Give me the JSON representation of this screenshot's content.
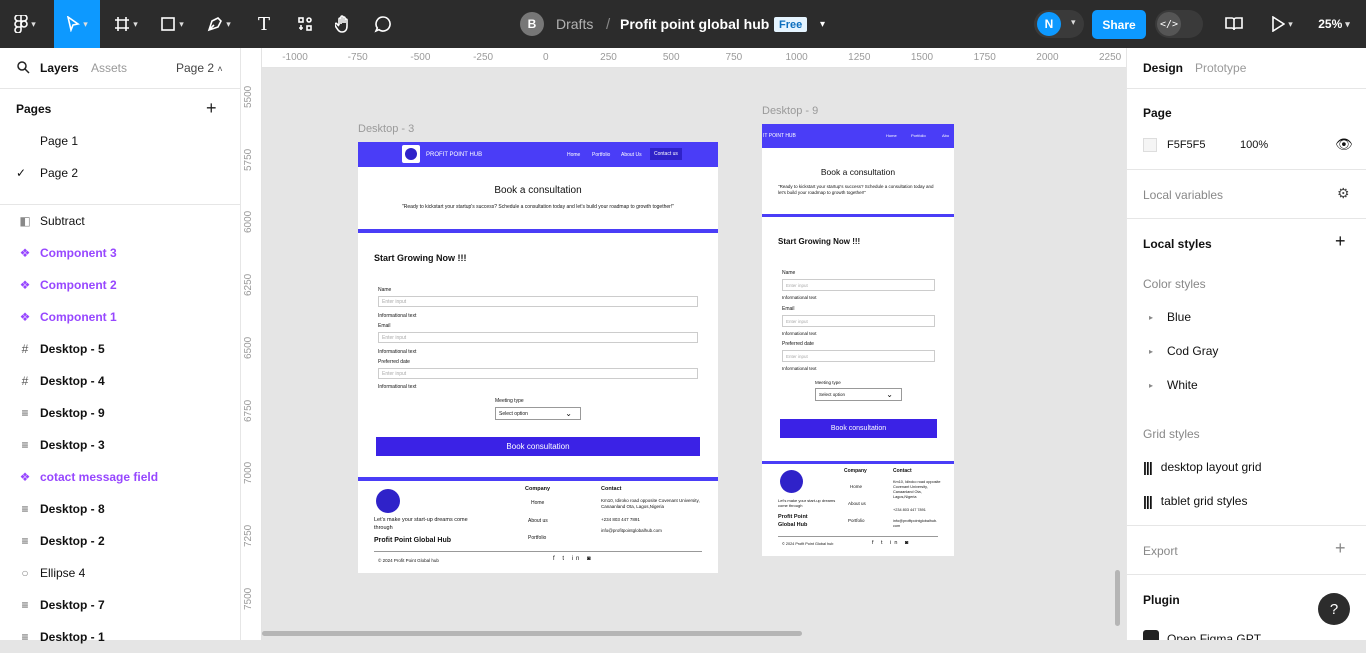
{
  "toolbar": {
    "breadcrumb_user": "B",
    "drafts": "Drafts",
    "file_name": "Profit point global hub",
    "badge": "Free",
    "avatar_initial": "N",
    "share": "Share",
    "zoom": "25%"
  },
  "left_panel": {
    "tab_layers": "Layers",
    "tab_assets": "Assets",
    "page_selector": "Page 2",
    "pages_title": "Pages",
    "pages": [
      "Page 1",
      "Page 2"
    ],
    "layers": [
      {
        "name": "Subtract",
        "type": "subtract"
      },
      {
        "name": "Component 3",
        "type": "component"
      },
      {
        "name": "Component 2",
        "type": "component"
      },
      {
        "name": "Component 1",
        "type": "component"
      },
      {
        "name": "Desktop - 5",
        "type": "frame"
      },
      {
        "name": "Desktop - 4",
        "type": "frame"
      },
      {
        "name": "Desktop - 9",
        "type": "layout"
      },
      {
        "name": "Desktop - 3",
        "type": "layout"
      },
      {
        "name": "cotact message field",
        "type": "component"
      },
      {
        "name": "Desktop - 8",
        "type": "layout"
      },
      {
        "name": "Desktop - 2",
        "type": "layout"
      },
      {
        "name": "Ellipse 4",
        "type": "ellipse"
      },
      {
        "name": "Desktop - 7",
        "type": "layout"
      },
      {
        "name": "Desktop - 1",
        "type": "layout"
      }
    ]
  },
  "rulers": {
    "top": [
      "-1000",
      "-750",
      "-500",
      "-250",
      "0",
      "250",
      "500",
      "750",
      "1000",
      "1250",
      "1500",
      "1750",
      "2000",
      "2250"
    ],
    "left": [
      "5500",
      "5750",
      "6000",
      "6250",
      "6500",
      "6750",
      "7000",
      "7250",
      "7500"
    ]
  },
  "desktop3": {
    "label": "Desktop - 3",
    "brand": "PROFIT POINT HUB",
    "nav": [
      "Home",
      "Portfolio",
      "About Us",
      "Contact us"
    ],
    "heading": "Book a consultation",
    "sub": "\"Ready to kickstart your startup's success? Schedule a consultation today and let's build your roadmap to growth together!\"",
    "start": "Start Growing Now !!!",
    "name": "Name",
    "email": "Email",
    "date": "Preferred date",
    "placeholder": "Enter input",
    "info": "Informational text",
    "meeting": "Meeting type",
    "select": "Select option",
    "button": "Book consultation",
    "footer_tag": "Let's make your start-up dreams come through",
    "footer_brand": "Profit Point Global Hub",
    "company": "Company",
    "links": [
      "Home",
      "About us",
      "Portfolio"
    ],
    "contact": "Contact",
    "address": "Km10, Idiroko road opposite Covenant University, Canaanland Ota, Lagos,Nigeria",
    "phone": "+234 803 447 7891",
    "mail": "info@profitpointglobalhub.com",
    "copyright": "© 2024 Profit Point Global hub"
  },
  "desktop9": {
    "label": "Desktop - 9",
    "brand": "IT POINT HUB",
    "nav": [
      "Home",
      "Portfolio",
      "Abo"
    ],
    "heading": "Book a consultation",
    "sub": "\"Ready to kickstart your startup's success? Schedule a consultation today and let's build your roadmap to growth together!\"",
    "start": "Start Growing Now !!!",
    "name": "Name",
    "email": "Email",
    "date": "Preferred date",
    "placeholder": "Enter input",
    "info": "Informational text",
    "meeting": "Meeting type",
    "select": "Select option",
    "button": "Book consultation",
    "footer_tag": "Let's make your start-up dreams come through",
    "footer_brand1": "Profit Point",
    "footer_brand2": "Global Hub",
    "company": "Company",
    "links": [
      "Home",
      "About us",
      "Portfolio"
    ],
    "contact": "Contact",
    "address": "Km10, Idiroko road opposite Covenant University, Canaanland Ota, Lagos,Nigeria",
    "phone": "+234 803 447 7891",
    "mail": "info@profitpointglobalhub.com",
    "copyright": "© 2024 Profit Point Global hub"
  },
  "right_panel": {
    "tab_design": "Design",
    "tab_prototype": "Prototype",
    "page": "Page",
    "page_color": "F5F5F5",
    "page_opacity": "100%",
    "local_variables": "Local variables",
    "local_styles": "Local styles",
    "color_styles": "Color styles",
    "colors": [
      "Blue",
      "Cod Gray",
      "White"
    ],
    "grid_styles": "Grid styles",
    "grids": [
      "desktop layout grid",
      "tablet grid styles"
    ],
    "export": "Export",
    "plugin": "Plugin",
    "plugin_item": "Open Figma GPT"
  },
  "colors": {
    "accent": "#0d99ff",
    "brand_blue": "#4a3df7",
    "button": "#3b22e6",
    "component_purple": "#9747ff",
    "toolbar": "#2c2c2c"
  }
}
